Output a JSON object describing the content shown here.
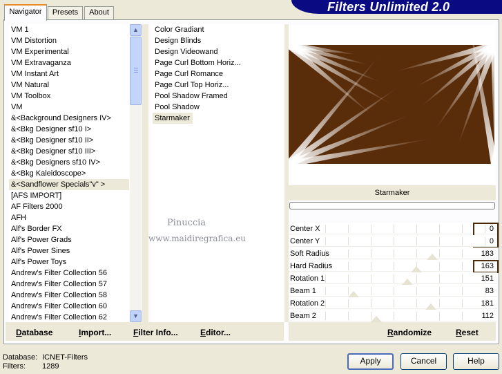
{
  "app": {
    "title": "Filters Unlimited 2.0"
  },
  "tabs": [
    {
      "label": "Navigator",
      "active": true
    },
    {
      "label": "Presets",
      "active": false
    },
    {
      "label": "About",
      "active": false
    }
  ],
  "categories": {
    "items": [
      "VM 1",
      "VM Distortion",
      "VM Experimental",
      "VM Extravaganza",
      "VM Instant Art",
      "VM Natural",
      "VM Toolbox",
      "VM",
      "&<Background Designers IV>",
      "&<Bkg Designer sf10 I>",
      "&<Bkg Designer sf10 II>",
      "&<Bkg Designer sf10 III>",
      "&<Bkg Designers sf10 IV>",
      "&<Bkg Kaleidoscope>",
      "&<Sandflower Specials\"v\" >",
      "[AFS IMPORT]",
      "AF Filters 2000",
      "AFH",
      "Alf's Border FX",
      "Alf's Power Grads",
      "Alf's Power Sines",
      "Alf's Power Toys",
      "Andrew's Filter Collection 56",
      "Andrew's Filter Collection 57",
      "Andrew's Filter Collection 58",
      "Andrew's Filter Collection 60",
      "Andrew's Filter Collection 62"
    ],
    "selected": "&<Sandflower Specials\"v\" >"
  },
  "filters": {
    "items": [
      "Color Gradiant",
      "Design Blinds",
      "Design Videowand",
      "Page Curl Bottom Horiz...",
      "Page Curl Romance",
      "Page Curl Top Horiz...",
      "Pool Shadow Framed",
      "Pool Shadow",
      "Starmaker"
    ],
    "selected": "Starmaker"
  },
  "watermark": {
    "line1": "Pinuccia",
    "line2": "www.maidiregrafica.eu"
  },
  "preview": {
    "filter_name": "Starmaker",
    "colors": {
      "background": "#5a2d0a",
      "rays": "#ffffff"
    }
  },
  "parameters": [
    {
      "label": "Center X",
      "value": "0",
      "level": 0,
      "highlighted": true
    },
    {
      "label": "Center Y",
      "value": "0",
      "level": 0,
      "highlighted": true
    },
    {
      "label": "Soft Radius",
      "value": "183",
      "level": 183,
      "highlighted": false
    },
    {
      "label": "Hard Radius",
      "value": "163",
      "level": 163,
      "highlighted": true
    },
    {
      "label": "Rotation 1",
      "value": "151",
      "level": 151,
      "highlighted": false
    },
    {
      "label": "Beam 1",
      "value": "83",
      "level": 83,
      "highlighted": false
    },
    {
      "label": "Rotation 2",
      "value": "181",
      "level": 181,
      "highlighted": false
    },
    {
      "label": "Beam 2",
      "value": "112",
      "level": 112,
      "highlighted": false
    }
  ],
  "toolbar_left": {
    "database": "Database",
    "import": "Import...",
    "filter_info": "Filter Info...",
    "editor": "Editor..."
  },
  "toolbar_right": {
    "randomize": "Randomize",
    "reset": "Reset"
  },
  "status": {
    "database_label": "Database:",
    "database_value": "ICNET-Filters",
    "filters_label": "Filters:",
    "filters_value": "1289"
  },
  "buttons": {
    "apply": "Apply",
    "cancel": "Cancel",
    "help": "Help"
  },
  "colors": {
    "highlight_border": "#4b2b0a",
    "tab_accent": "#e68b2c",
    "banner": "#0a0a82"
  }
}
